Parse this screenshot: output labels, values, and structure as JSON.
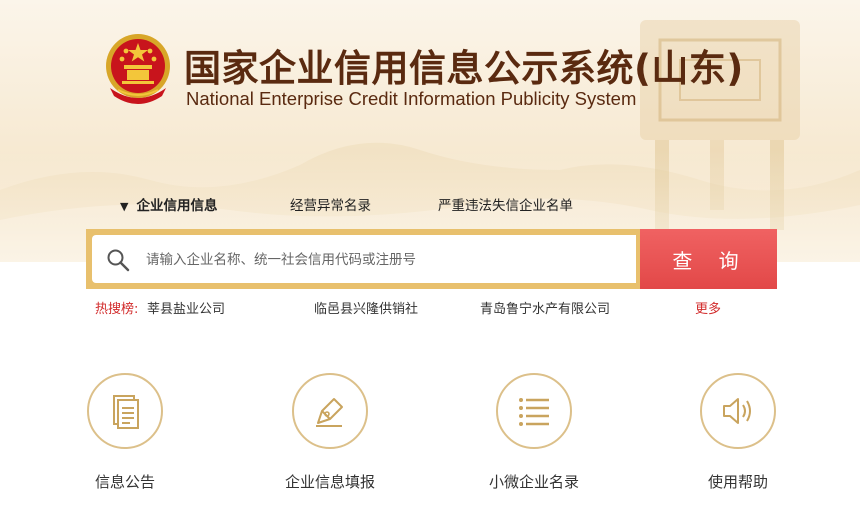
{
  "header": {
    "title_cn": "国家企业信用信息公示系统(山东)",
    "title_en": "National Enterprise Credit Information Publicity System"
  },
  "tabs": [
    {
      "label": "企业信用信息",
      "active": true
    },
    {
      "label": "经营异常名录",
      "active": false
    },
    {
      "label": "严重违法失信企业名单",
      "active": false
    }
  ],
  "search": {
    "placeholder": "请输入企业名称、统一社会信用代码或注册号",
    "button_label": "查 询"
  },
  "hot_search": {
    "label": "热搜榜:",
    "items": [
      "莘县盐业公司",
      "临邑县兴隆供销社",
      "青岛鲁宁水产有限公司"
    ],
    "more_label": "更多"
  },
  "features": [
    {
      "label": "信息公告",
      "icon": "document-icon"
    },
    {
      "label": "企业信息填报",
      "icon": "pen-icon"
    },
    {
      "label": "小微企业名录",
      "icon": "list-icon"
    },
    {
      "label": "使用帮助",
      "icon": "speaker-icon"
    }
  ],
  "colors": {
    "brand_brown": "#5a2a10",
    "accent_gold": "#e8c06d",
    "button_red": "#e24848",
    "hot_red": "#d22b2b",
    "icon_gold": "#c9a45e"
  }
}
